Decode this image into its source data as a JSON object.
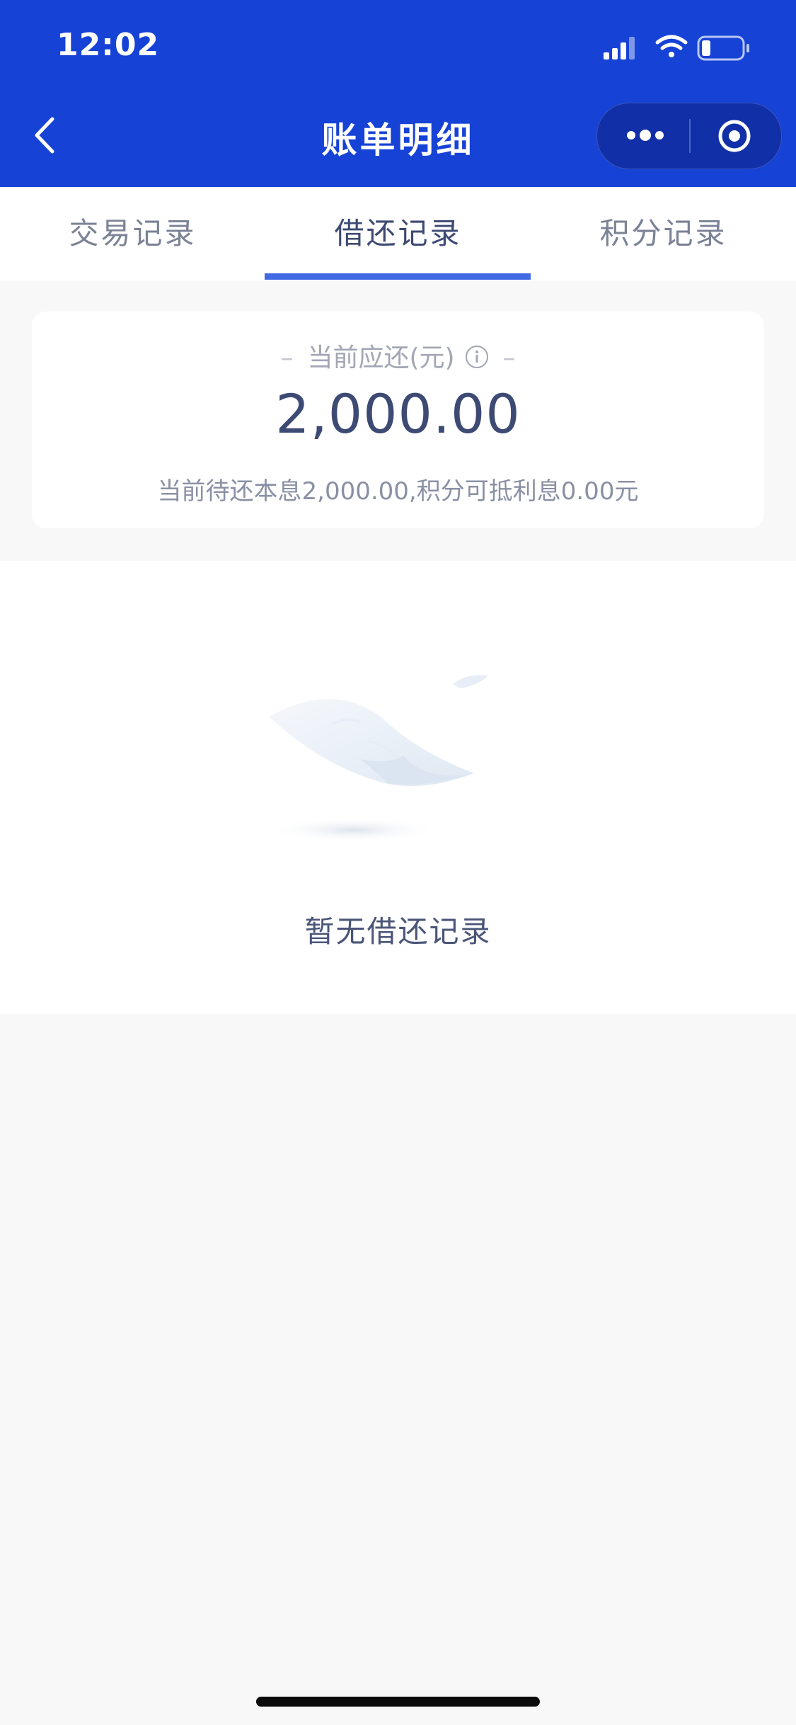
{
  "status_bar": {
    "time": "12:02",
    "icons": [
      "signal-icon",
      "wifi-icon",
      "battery-icon"
    ]
  },
  "nav": {
    "title": "账单明细",
    "back_icon": "chevron-left-icon",
    "capsule_icons": [
      "more-icon",
      "target-icon"
    ]
  },
  "tabs": [
    {
      "label": "交易记录",
      "active": false
    },
    {
      "label": "借还记录",
      "active": true
    },
    {
      "label": "积分记录",
      "active": false
    }
  ],
  "summary": {
    "label": "当前应还(元)",
    "amount": "2,000.00",
    "note": "当前待还本息2,000.00,积分可抵利息0.00元"
  },
  "empty_state": {
    "text": "暂无借还记录",
    "illustration": "paper-illustration"
  },
  "colors": {
    "header_bg": "#1642d6",
    "accent": "#4169e1",
    "text_primary": "#3d4a73",
    "text_secondary": "#8a90a4",
    "page_bg": "#f8f8f9"
  }
}
